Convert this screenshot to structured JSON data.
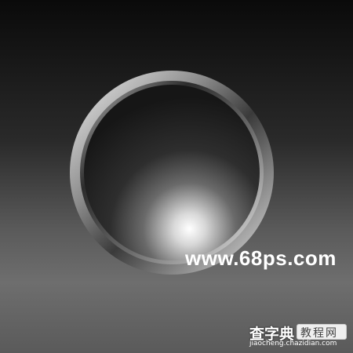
{
  "watermark": {
    "site": "www.68ps.com",
    "brand_cn": "查字典",
    "brand_box": "教程网",
    "brand_url": "jiaocheng.chazidian.com"
  },
  "colors": {
    "background_top": "#0a0a0a",
    "background_mid": "#6e6e6e",
    "ring_light": "#e6e6e6",
    "ring_dark": "#3a3a3a",
    "face_dark": "#1b1b1b",
    "highlight": "#ffffff"
  }
}
